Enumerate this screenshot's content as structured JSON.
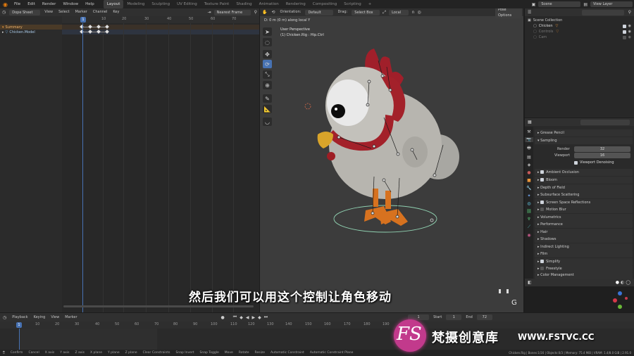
{
  "topbar": {
    "menus": [
      "File",
      "Edit",
      "Render",
      "Window",
      "Help"
    ],
    "workspaces": [
      "Layout",
      "Modeling",
      "Sculpting",
      "UV Editing",
      "Texture Paint",
      "Shading",
      "Animation",
      "Rendering",
      "Compositing",
      "Scripting",
      "+"
    ],
    "active_workspace": "Layout",
    "scene": "Scene",
    "view_layer": "View Layer"
  },
  "dopesheet": {
    "mode": "Dope Sheet",
    "menus": [
      "View",
      "Select",
      "Marker",
      "Channel",
      "Key"
    ],
    "snap": "Nearest Frame",
    "channels": [
      {
        "label": "Summary",
        "highlight": true
      },
      {
        "label": "Chicken.Model",
        "highlight": false
      }
    ],
    "ruler_ticks": [
      "1",
      "10",
      "20",
      "30",
      "40",
      "50",
      "60",
      "70"
    ],
    "current_frame": "1"
  },
  "viewport": {
    "orientation_label": "Orientation:",
    "orientation": "Default",
    "drag_label": "Drag:",
    "drag": "Select Box",
    "transform": "Local",
    "pose_options": "Pose Options",
    "status": "D: 0 m (0 m) along local Y",
    "perspective": "User Perspective",
    "selection": "(1) Chicken.Rig : Hip.Ctrl",
    "corner_letter": "G"
  },
  "outliner": {
    "title": "Scene Collection",
    "items": [
      {
        "label": "Chicken",
        "dim": false
      },
      {
        "label": "Controls",
        "dim": true
      },
      {
        "label": "Cam",
        "dim": true
      }
    ]
  },
  "properties": {
    "panels": [
      {
        "label": "Grease Pencil",
        "check": false,
        "checked": false
      },
      {
        "label": "Sampling",
        "check": false,
        "checked": false,
        "open": true
      },
      {
        "label": "Ambient Occlusion",
        "check": true,
        "checked": true
      },
      {
        "label": "Bloom",
        "check": true,
        "checked": true
      },
      {
        "label": "Depth of Field",
        "check": false,
        "checked": false
      },
      {
        "label": "Subsurface Scattering",
        "check": false,
        "checked": false
      },
      {
        "label": "Screen Space Reflections",
        "check": true,
        "checked": true
      },
      {
        "label": "Motion Blur",
        "check": true,
        "checked": false
      },
      {
        "label": "Volumetrics",
        "check": false,
        "checked": false
      },
      {
        "label": "Performance",
        "check": false,
        "checked": false
      },
      {
        "label": "Hair",
        "check": false,
        "checked": false
      },
      {
        "label": "Shadows",
        "check": false,
        "checked": false
      },
      {
        "label": "Indirect Lighting",
        "check": false,
        "checked": false
      },
      {
        "label": "Film",
        "check": false,
        "checked": false
      },
      {
        "label": "Simplify",
        "check": true,
        "checked": true
      },
      {
        "label": "Freestyle",
        "check": true,
        "checked": false
      },
      {
        "label": "Color Management",
        "check": false,
        "checked": false
      }
    ],
    "render_label": "Render",
    "render_value": "32",
    "viewport_label": "Viewport",
    "viewport_value": "16",
    "denoise_label": "Viewport Denoising"
  },
  "timeline": {
    "menus": [
      "Playback",
      "Keying",
      "View",
      "Marker"
    ],
    "current_frame": "1",
    "start_label": "Start",
    "start": "1",
    "end_label": "End",
    "end": "72",
    "ticks": [
      "1",
      "10",
      "20",
      "30",
      "40",
      "50",
      "60",
      "70",
      "80",
      "90",
      "100",
      "110",
      "120",
      "130",
      "140",
      "150",
      "160",
      "170",
      "180",
      "190"
    ]
  },
  "statusbar": {
    "items": [
      "Confirm",
      "Cancel",
      "X axis",
      "Y axis",
      "Z axis",
      "X plane",
      "Y plane",
      "Z plane",
      "Clear Constraints",
      "Snap Invert",
      "Snap Toggle",
      "Move",
      "Rotate",
      "Resize",
      "Automatic Constraint",
      "Automatic Constraint Plane"
    ],
    "info": "Chicken.Rig | Bones:1/16 | Objects:0/3 | Memory: 75.4 MiB | VRAM: 1.4/8.0 GiB | 2.91.0"
  },
  "subtitle": "然后我们可以用这个控制让角色移动",
  "watermark": {
    "logo": "FS",
    "text": "梵摄创意库",
    "url": "WWW.FSTVC.CC"
  },
  "colors": {
    "accent": "#4772b3",
    "summary": "#e8963a",
    "keyframe": "#e0e0e0",
    "playhead": "#4772b3"
  }
}
